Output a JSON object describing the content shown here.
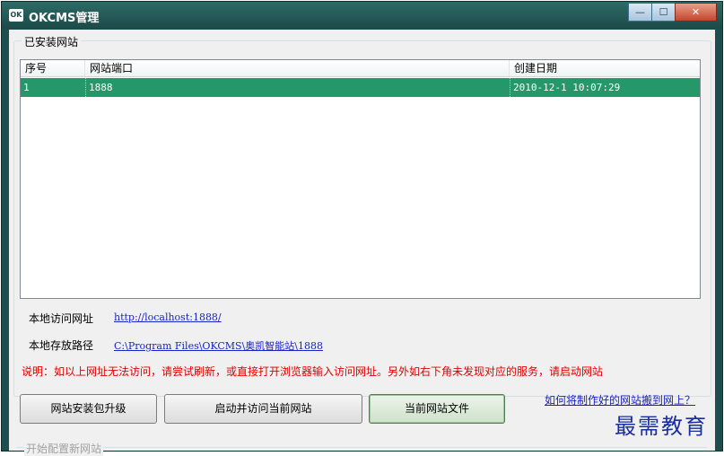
{
  "window": {
    "title": "OKCMS管理",
    "icon_text": "OK",
    "controls": {
      "minimize": "—",
      "maximize": "☐",
      "close": "✕"
    }
  },
  "installed_group": {
    "label": "已安装网站",
    "columns": [
      "序号",
      "网站端口",
      "创建日期"
    ],
    "rows": [
      {
        "index": "1",
        "port": "1888",
        "created": "2010-12-1 10:07:29"
      }
    ]
  },
  "info": {
    "local_url_label": "本地访问网址",
    "local_url": "http://localhost:1888/",
    "local_path_label": "本地存放路径",
    "local_path": "C:\\Program Files\\OKCMS\\奥凯智能站\\1888",
    "note": "说明：如以上网址无法访问，请尝试刷新，或直接打开浏览器输入访问网址。另外如右下角未发现对应的服务，请启动网站"
  },
  "buttons": {
    "upgrade": "网站安装包升级",
    "start_visit": "启动并访问当前网站",
    "current_files": "当前网站文件"
  },
  "help_link": "如何将制作好的网站搬到网上？",
  "new_site_group": {
    "label": "开始配置新网站"
  },
  "watermark": "最需教育",
  "colors": {
    "selection": "#25986a",
    "link": "#1a22c8",
    "note": "#e00000",
    "titlebar": "#1e4e4d"
  }
}
